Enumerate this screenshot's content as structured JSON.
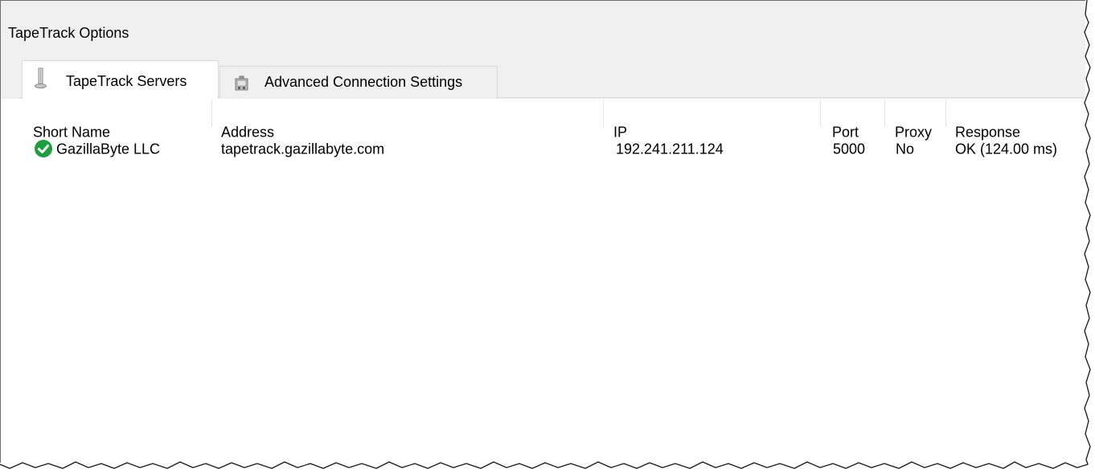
{
  "window": {
    "title": "TapeTrack Options"
  },
  "tabs": [
    {
      "label": "TapeTrack Servers",
      "icon": "server-tower-icon",
      "active": true
    },
    {
      "label": "Advanced Connection Settings",
      "icon": "network-settings-icon",
      "active": false
    }
  ],
  "table": {
    "columns": [
      "Short Name",
      "Address",
      "IP",
      "Port",
      "Proxy",
      "Response"
    ],
    "rows": [
      {
        "status_icon": "green-check-icon",
        "short_name": "GazillaByte LLC",
        "address": "tapetrack.gazillabyte.com",
        "ip": "192.241.211.124",
        "port": "5000",
        "proxy": "No",
        "response": "OK (124.00 ms)"
      }
    ]
  },
  "colors": {
    "chrome_background": "#f0f0f0",
    "list_background": "#ffffff",
    "status_ok": "#1e9e3f"
  }
}
